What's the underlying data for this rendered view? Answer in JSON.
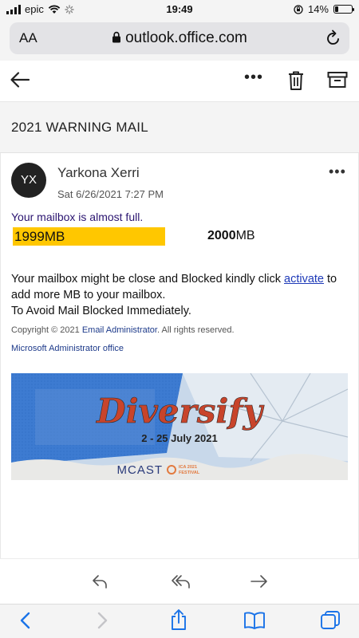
{
  "status_bar": {
    "carrier": "epic",
    "time": "19:49",
    "battery": "14%"
  },
  "browser": {
    "text_size_label": "AA",
    "url": "outlook.office.com"
  },
  "mail": {
    "subject": "2021 WARNING MAIL",
    "sender": {
      "initials": "YX",
      "name": "Yarkona Xerri"
    },
    "date": "Sat 6/26/2021 7:27 PM",
    "alert": "Your mailbox is almost full.",
    "quota_used": "1999MB",
    "quota_total_number": "2000",
    "quota_total_unit": "MB",
    "quota_fill": 0.9995,
    "body_part1": "Your mailbox might be close and Blocked kindly click ",
    "body_link": "activate",
    "body_part2": " to add more MB to your mailbox.",
    "body_line2": "To Avoid Mail Blocked Immediately.",
    "copyright_prefix": "Copyright © 2021 ",
    "copyright_org": "Email Administrator",
    "copyright_suffix": ". All rights reserved.",
    "signature": "Microsoft Administrator office"
  },
  "banner": {
    "title": "Diversify",
    "dates": "2 - 25 July 2021",
    "brand": "MCAST",
    "sub_top": "ICA 2021",
    "sub_bottom": "FESTIVAL"
  },
  "colors": {
    "quota_bar": "#ffc700",
    "link": "#1e3ab8",
    "alert_text": "#2a1470",
    "banner_red": "#c8442b"
  },
  "icons": {
    "toolbar": [
      "back-arrow-icon",
      "more-icon",
      "trash-icon",
      "archive-icon"
    ],
    "reply_bar": [
      "reply-icon",
      "reply-all-icon",
      "forward-icon"
    ],
    "safari_bar": [
      "back-icon",
      "forward-icon",
      "share-icon",
      "bookmarks-icon",
      "tabs-icon"
    ]
  }
}
